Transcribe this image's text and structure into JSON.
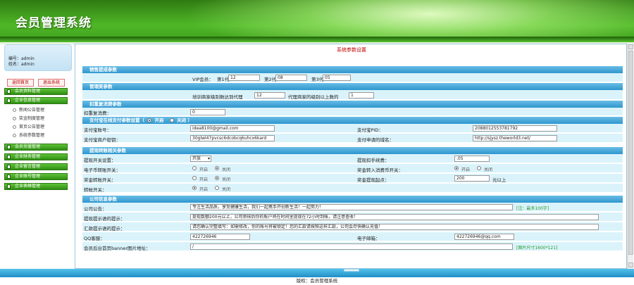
{
  "app": {
    "title": "会员管理系统",
    "footer": "版权：会员管理系统"
  },
  "user": {
    "id_line": "编号：admin",
    "name_line": "姓名：admin"
  },
  "sidebar": {
    "home_button": "返回首页",
    "exit_button": "退出系统",
    "menu": [
      {
        "label": "会员资料管理",
        "children": []
      },
      {
        "label": "企业信息管理",
        "children": [
          "新闻公告管理",
          "奖金制度管理",
          "首页公告管理",
          "系统参数管理"
        ]
      },
      {
        "label": "会员充值管理",
        "children": []
      },
      {
        "label": "企业财务管理",
        "children": []
      },
      {
        "label": "企业留言管理",
        "children": []
      },
      {
        "label": "企业账号管理",
        "children": []
      },
      {
        "label": "企业表格管理",
        "children": []
      }
    ]
  },
  "page": {
    "title": "系统参数设置"
  },
  "sections": {
    "sales": {
      "header": "销售提成参数",
      "vip_label": "VIP会员：",
      "gen1_label": "第1代",
      "gen1_value": "12",
      "gen2_label": "第2代",
      "gen2_value": "08",
      "gen3_label": "第3代",
      "gen3_value": "05"
    },
    "management": {
      "header": "管理奖参数",
      "text1": "培训商家级别数达到代理",
      "value1": "12",
      "text2": "代理商家的级别以上数的",
      "value2": "1"
    },
    "deduction": {
      "header": "扣重复消费参数",
      "label": "扣重复消费：",
      "value": "0"
    },
    "payment": {
      "header": "支付宝在线支付参数设置（",
      "on_label": "开启",
      "off_label": "关闭",
      "header_suffix": "）",
      "account_label": "支付宝账号：",
      "account_value": "idea8100@gmail.com",
      "pid_label": "支付宝PID：",
      "pid_value": "2088012553781792",
      "key_label": "支付宝商户密钥：",
      "key_value": "30glwl47pvcsc6dcobcq6uhcx6kard",
      "domain_label": "支付申请的域名：",
      "domain_value": "http://sjysz.theworld3.net/"
    },
    "transfer": {
      "header": "提现转账相关参数",
      "withdraw_label": "提现开关设置：",
      "withdraw_value": "开放",
      "fee_label": "提现扣手续费：",
      "fee_value": ".05",
      "ecoin_label": "电子币转账开关：",
      "bonus_label": "奖金转入消费币开关：",
      "bonus_transfer_label": "奖金转账开关：",
      "min_label": "奖金提现起点：",
      "min_value": "200",
      "min_suffix": "元以上",
      "bonus2_label": "转帐开关：",
      "on_label": "开启",
      "off_label": "关闭"
    },
    "company": {
      "header": "公司信息参数",
      "notice_label": "公司公告：",
      "notice_value": "专注生活品质，享受健康生活，我们一起携手开创新生活！一起努力！",
      "notice_note": "[注：最多100字]",
      "withdraw_tip_label": "提现提示语的提示：",
      "withdraw_tip_value": "提现数额200元以上，公司审核后你的账户将在时间里提现在72小时到帐，请注意查收！",
      "register_tip_label": "汇款提示语的提示：",
      "register_tip_value": "请您确认完整填写：如需修改，你的账号将被锁定！您的汇款请按照这样汇款，公司会尽快确认充值！",
      "qq_label": "QQ客服：",
      "qq_value": "422726946",
      "email_label": "电子邮箱：",
      "email_value": "422726946@qq.com",
      "banner_label": "会员后台首页banner图片地址：",
      "banner_value": "/",
      "banner_note": "[图片尺寸1600*121]"
    }
  }
}
